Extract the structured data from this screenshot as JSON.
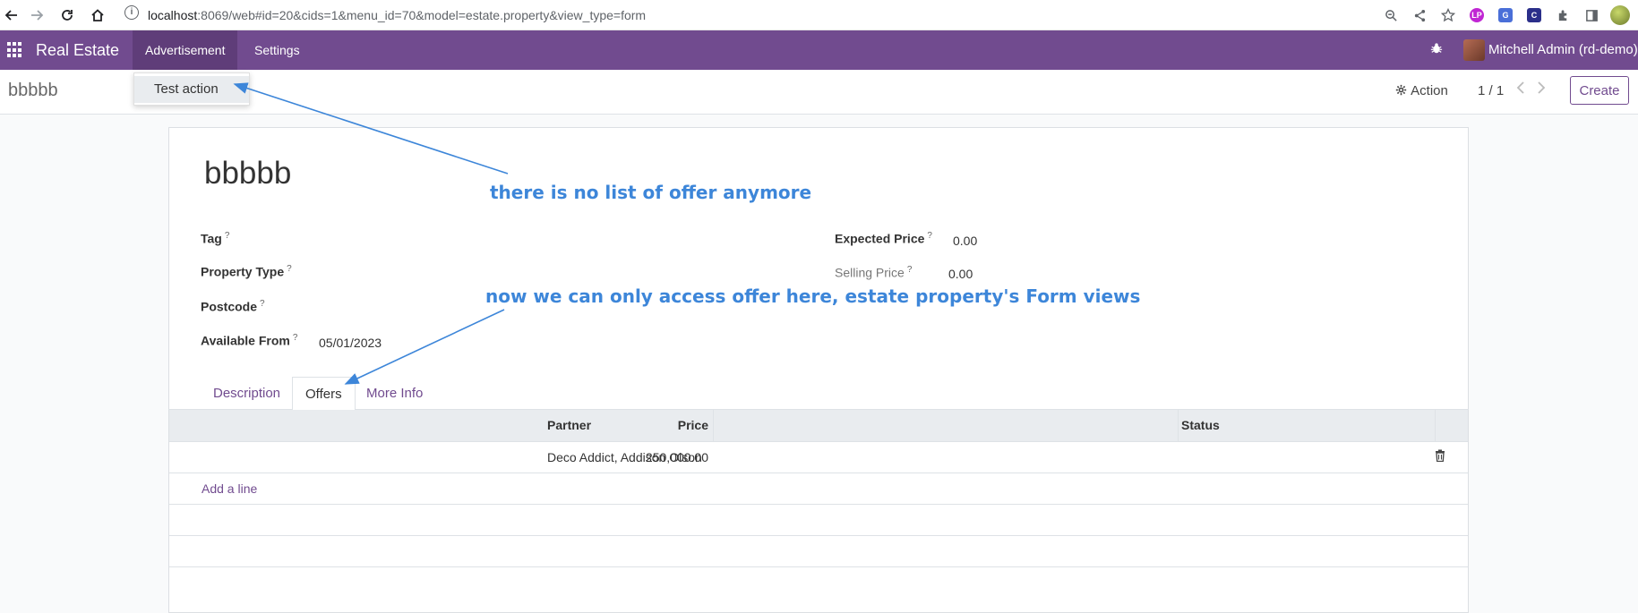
{
  "browser": {
    "url_host": "localhost",
    "url_path": ":8069/web#id=20&cids=1&menu_id=70&model=estate.property&view_type=form",
    "icons": [
      "back-icon",
      "forward-icon",
      "reload-icon",
      "home-icon",
      "info-icon",
      "zoom-icon",
      "share-icon",
      "star-icon",
      "extension-icon",
      "sidebar-icon",
      "profile-icon"
    ],
    "extensions": [
      {
        "label": "LP",
        "color": "#c026d3"
      },
      {
        "label": "G",
        "color": "#4a6fd8"
      },
      {
        "label": "C",
        "color": "#2b2f8a"
      }
    ]
  },
  "navbar": {
    "brand": "Real Estate",
    "menus": [
      {
        "label": "Advertisement",
        "active": true
      },
      {
        "label": "Settings",
        "active": false
      }
    ],
    "user": "Mitchell Admin (rd-demo)",
    "color": "#714B8F"
  },
  "dropdown": {
    "items": [
      "Test action"
    ]
  },
  "control_panel": {
    "title": "bbbbb",
    "action_label": "Action",
    "pager": "1 / 1",
    "create_label": "Create"
  },
  "form": {
    "name": "bbbbb",
    "fields_left": [
      {
        "label": "Tag",
        "value": ""
      },
      {
        "label": "Property Type",
        "value": ""
      },
      {
        "label": "Postcode",
        "value": ""
      },
      {
        "label": "Available From",
        "value": "05/01/2023"
      }
    ],
    "fields_right": [
      {
        "label": "Expected Price",
        "value": "0.00"
      },
      {
        "label": "Selling Price",
        "value": "0.00"
      }
    ],
    "help_mark": "?"
  },
  "tabs": [
    {
      "label": "Description",
      "active": false
    },
    {
      "label": "Offers",
      "active": true
    },
    {
      "label": "More Info",
      "active": false
    }
  ],
  "offers_table": {
    "columns": [
      "Price",
      "Partner",
      "Status"
    ],
    "rows": [
      {
        "price": "250,000.00",
        "partner": "Deco Addict, Addison Olson",
        "status": ""
      }
    ],
    "add_line": "Add a line"
  },
  "annotations": {
    "note_1": "there is no list of offer anymore",
    "note_2": "now we can only access offer here, estate property's Form views",
    "color": "#3d86d9"
  }
}
